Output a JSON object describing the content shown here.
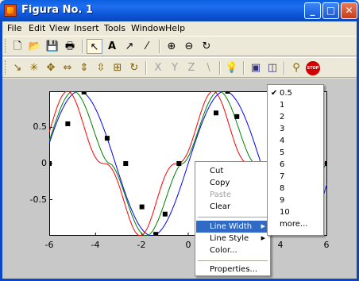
{
  "window": {
    "title": "Figura No. 1",
    "controls": {
      "minimize": "_",
      "maximize": "□",
      "close": "✕"
    }
  },
  "menubar": {
    "items": [
      "File",
      "Edit",
      "View",
      "Insert",
      "Tools",
      "Window",
      "Help"
    ]
  },
  "toolbar1": {
    "tools": [
      {
        "name": "new-figure-icon",
        "glyph": "🗋"
      },
      {
        "name": "open-file-icon",
        "glyph": "📂"
      },
      {
        "name": "save-icon",
        "glyph": "💾"
      },
      {
        "name": "print-icon",
        "glyph": "🖶"
      },
      {
        "name": "edit-plot-arrow-icon",
        "glyph": "↖"
      },
      {
        "name": "insert-text-icon",
        "glyph": "A"
      },
      {
        "name": "insert-arrow-icon",
        "glyph": "↗"
      },
      {
        "name": "insert-line-icon",
        "glyph": "⁄"
      },
      {
        "name": "zoom-in-icon",
        "glyph": "⊕"
      },
      {
        "name": "zoom-out-icon",
        "glyph": "⊖"
      },
      {
        "name": "rotate-3d-icon",
        "glyph": "↻"
      }
    ]
  },
  "toolbar2": {
    "tools": [
      {
        "name": "camera-orbit-icon",
        "glyph": "↘"
      },
      {
        "name": "camera-orbit-scene-icon",
        "glyph": "✳"
      },
      {
        "name": "camera-pan-tilt-icon",
        "glyph": "✥"
      },
      {
        "name": "camera-dolly-horizontal-icon",
        "glyph": "⇔"
      },
      {
        "name": "camera-dolly-vertical-icon",
        "glyph": "⇕"
      },
      {
        "name": "camera-dolly-forward-icon",
        "glyph": "⇳"
      },
      {
        "name": "camera-zoom-icon",
        "glyph": "⊞"
      },
      {
        "name": "camera-roll-icon",
        "glyph": "↻"
      },
      {
        "name": "principal-axis-x-icon",
        "glyph": "X"
      },
      {
        "name": "principal-axis-y-icon",
        "glyph": "Y"
      },
      {
        "name": "principal-axis-z-icon",
        "glyph": "Z"
      },
      {
        "name": "principal-axis-none-icon",
        "glyph": "∖"
      },
      {
        "name": "light-bulb-icon",
        "glyph": "💡"
      },
      {
        "name": "orthographic-projection-icon",
        "glyph": "▣"
      },
      {
        "name": "perspective-projection-icon",
        "glyph": "◫"
      },
      {
        "name": "reset-camera-icon",
        "glyph": "⚲"
      },
      {
        "name": "stop-icon",
        "glyph": "STOP"
      }
    ]
  },
  "context_menu": {
    "items": [
      "Cut",
      "Copy",
      "Paste",
      "Clear",
      "Line Width",
      "Line Style",
      "Color...",
      "Properties..."
    ],
    "highlighted": "Line Width",
    "disabled": [
      "Paste"
    ]
  },
  "submenu": {
    "items": [
      "0.5",
      "1",
      "2",
      "3",
      "4",
      "5",
      "6",
      "7",
      "8",
      "9",
      "10",
      "more..."
    ],
    "checked": "0.5"
  },
  "colors": {
    "series_blue": "#0000ff",
    "series_green": "#008000",
    "series_red": "#ff0000",
    "highlight": "#316ac5"
  },
  "chart_data": {
    "type": "line",
    "xlim": [
      -6,
      6
    ],
    "ylim": [
      -1,
      1
    ],
    "xticks": [
      "-6",
      "-4",
      "-2",
      "0",
      "2",
      "4",
      "6"
    ],
    "yticks": [
      "0.5",
      "0",
      "-0.5"
    ],
    "series": [
      {
        "color": "blue",
        "fn": "sin",
        "shift": 0.0
      },
      {
        "color": "green",
        "fn": "sin",
        "shift": 0.25
      },
      {
        "color": "red",
        "fn": "sin",
        "shift": 0.5
      }
    ],
    "markers": {
      "x": [
        -6,
        -5.2,
        -4.5,
        -3.5,
        -2.7,
        -2.0,
        -1.4,
        -1.0,
        -0.4,
        0.4,
        1.2,
        1.7,
        2.1,
        2.8,
        3.4,
        4.4,
        6.0
      ],
      "y": [
        0.0,
        0.55,
        0.99,
        0.35,
        0.0,
        -0.6,
        -0.98,
        -0.7,
        0.0,
        0.0,
        0.7,
        1.0,
        0.65,
        0.0,
        -0.5,
        -0.4,
        0.0
      ]
    }
  }
}
